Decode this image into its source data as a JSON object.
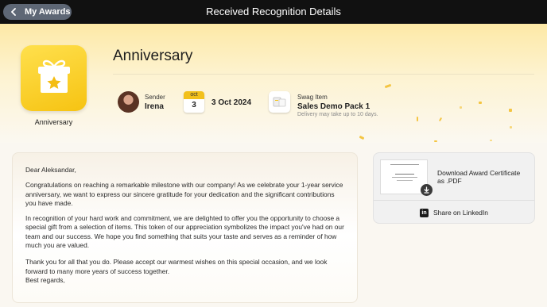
{
  "header": {
    "back_label": "My Awards",
    "title": "Received Recognition Details"
  },
  "award": {
    "icon": "gift-star-icon",
    "caption": "Anniversary",
    "title": "Anniversary"
  },
  "sender": {
    "label": "Sender",
    "name": "Irena"
  },
  "date": {
    "month": "oct",
    "day": "3",
    "full": "3 Oct 2024"
  },
  "swag": {
    "label": "Swag Item",
    "name": "Sales Demo Pack 1",
    "note": "Delivery may take up to 10 days."
  },
  "message": {
    "greeting": "Dear Aleksandar,",
    "para1": "Congratulations on reaching a remarkable milestone with our company! As we celebrate your 1-year service anniversary, we want to express our sincere gratitude for your dedication and the significant contributions you have made.",
    "para2": "In recognition of your hard work and commitment, we are delighted to offer you the opportunity to choose a special gift from a selection of items. This token of our appreciation symbolizes the impact you've had on our team and our success. We hope you find something that suits your taste and serves as a reminder of how much you are valued.",
    "para3": "Thank you for all that you do. Please accept our warmest wishes on this special occasion, and we look forward to many more years of success together.",
    "closing": "Best regards,"
  },
  "actions": {
    "download_label": "Download Award Certificate as .PDF",
    "share_label": "Share on LinkedIn"
  },
  "colors": {
    "accent": "#f6c312",
    "topbar": "#111111",
    "back_button": "#5e6775"
  }
}
